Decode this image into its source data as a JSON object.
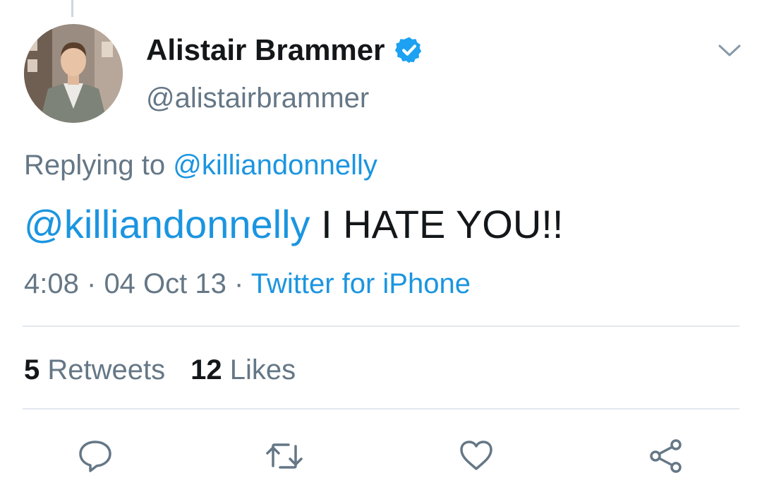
{
  "tweet": {
    "author": {
      "display_name": "Alistair Brammer",
      "handle": "@alistairbrammer",
      "verified": true
    },
    "reply": {
      "prefix": "Replying to",
      "mention": "@killiandonnelly"
    },
    "body": {
      "mention": "@killiandonnelly",
      "text": "I HATE YOU!!"
    },
    "meta": {
      "time": "4:08",
      "separator": "·",
      "date": "04 Oct 13",
      "source": "Twitter for iPhone"
    },
    "stats": {
      "retweets_count": "5",
      "retweets_label": "Retweets",
      "likes_count": "12",
      "likes_label": "Likes"
    },
    "actions": {
      "reply_icon": "reply-icon",
      "retweet_icon": "retweet-icon",
      "like_icon": "heart-icon",
      "share_icon": "share-icon"
    }
  },
  "colors": {
    "link": "#1b95e0",
    "secondary_text": "#657786",
    "primary_text": "#14171a",
    "verified": "#1da1f2",
    "divider": "#e1e8ed"
  }
}
